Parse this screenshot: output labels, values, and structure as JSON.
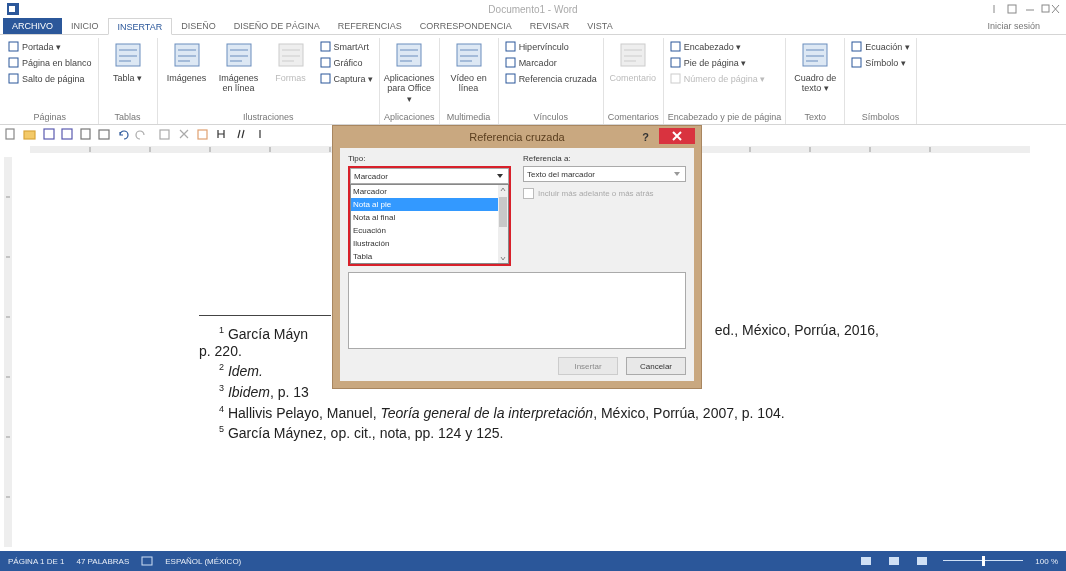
{
  "window": {
    "title": "Documento1 - Word"
  },
  "tabs": [
    {
      "label": "ARCHIVO",
      "kind": "file",
      "selected": false
    },
    {
      "label": "INICIO",
      "kind": "tab",
      "selected": false
    },
    {
      "label": "INSERTAR",
      "kind": "tab",
      "selected": true
    },
    {
      "label": "DISEÑO",
      "kind": "tab",
      "selected": false
    },
    {
      "label": "DISEÑO DE PÁGINA",
      "kind": "tab",
      "selected": false
    },
    {
      "label": "REFERENCIAS",
      "kind": "tab",
      "selected": false
    },
    {
      "label": "CORRESPONDENCIA",
      "kind": "tab",
      "selected": false
    },
    {
      "label": "REVISAR",
      "kind": "tab",
      "selected": false
    },
    {
      "label": "VISTA",
      "kind": "tab",
      "selected": false
    }
  ],
  "account": "Iniciar sesión",
  "ribbon": {
    "groups": [
      {
        "label": "Páginas",
        "small": [
          {
            "label": "Portada ▾",
            "disabled": false
          },
          {
            "label": "Página en blanco",
            "disabled": false
          },
          {
            "label": "Salto de página",
            "disabled": false
          }
        ]
      },
      {
        "label": "Tablas",
        "large": [
          {
            "label": "Tabla ▾",
            "disabled": false
          }
        ]
      },
      {
        "label": "Ilustraciones",
        "large": [
          {
            "label": "Imágenes",
            "disabled": false
          },
          {
            "label": "Imágenes en línea",
            "disabled": false
          },
          {
            "label": "Formas",
            "disabled": true
          }
        ],
        "small": [
          {
            "label": "SmartArt",
            "disabled": false
          },
          {
            "label": "Gráfico",
            "disabled": false
          },
          {
            "label": "Captura ▾",
            "disabled": false
          }
        ]
      },
      {
        "label": "Aplicaciones",
        "large": [
          {
            "label": "Aplicaciones para Office ▾",
            "disabled": false
          }
        ]
      },
      {
        "label": "Multimedia",
        "large": [
          {
            "label": "Vídeo en línea",
            "disabled": false
          }
        ]
      },
      {
        "label": "Vínculos",
        "small": [
          {
            "label": "Hipervínculo",
            "disabled": false
          },
          {
            "label": "Marcador",
            "disabled": false
          },
          {
            "label": "Referencia cruzada",
            "disabled": false
          }
        ]
      },
      {
        "label": "Comentarios",
        "large": [
          {
            "label": "Comentario",
            "disabled": true
          }
        ]
      },
      {
        "label": "Encabezado y pie de página",
        "small": [
          {
            "label": "Encabezado ▾",
            "disabled": false
          },
          {
            "label": "Pie de página ▾",
            "disabled": false
          },
          {
            "label": "Número de página ▾",
            "disabled": true
          }
        ]
      },
      {
        "label": "Texto",
        "large": [
          {
            "label": "Cuadro de texto ▾",
            "disabled": false
          }
        ]
      },
      {
        "label": "Símbolos",
        "small": [
          {
            "label": "Ecuación ▾",
            "disabled": false
          },
          {
            "label": "Símbolo ▾",
            "disabled": false
          }
        ]
      }
    ]
  },
  "document": {
    "footnotes": [
      {
        "mark": "1",
        "text": "García Máyn",
        "text_after": "ed., México, Porrúa, 2016,",
        "continuation": "p. 220."
      },
      {
        "mark": "2",
        "text": "*Idem.*"
      },
      {
        "mark": "3",
        "text": "*Ibidem*, p. 13"
      },
      {
        "mark": "4",
        "text": "Hallivis Pelayo, Manuel, *Teoría general de la interpretación*, México, Porrúa, 2007, p. 104."
      },
      {
        "mark": "5",
        "text": "García Máynez, op. cit., nota, pp. 124 y 125."
      }
    ]
  },
  "dialog": {
    "title": "Referencia cruzada",
    "help": "?",
    "type_label": "Tipo:",
    "type_value": "Marcador",
    "type_options": [
      {
        "label": "Marcador",
        "selected": false
      },
      {
        "label": "Nota al pie",
        "selected": true
      },
      {
        "label": "Nota al final",
        "selected": false
      },
      {
        "label": "Ecuación",
        "selected": false
      },
      {
        "label": "Ilustración",
        "selected": false
      },
      {
        "label": "Tabla",
        "selected": false
      }
    ],
    "reference_label": "Referencia a:",
    "reference_value": "Texto del marcador",
    "include_option": {
      "label": "Incluir más adelante o más atrás",
      "checked": false,
      "disabled": true
    },
    "buttons": [
      {
        "label": "Insertar",
        "disabled": true
      },
      {
        "label": "Cancelar",
        "disabled": false
      }
    ]
  },
  "status_bar": {
    "page": "PÁGINA 1 DE 1",
    "words": "47 PALABRAS",
    "language": "ESPAÑOL (MÉXICO)",
    "zoom": {
      "level": 0.5
    },
    "zoom_text": "100 %"
  }
}
